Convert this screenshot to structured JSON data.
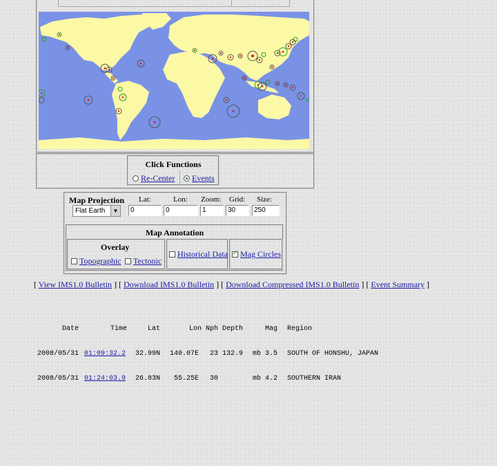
{
  "click_functions": {
    "title": "Click Functions",
    "options": [
      {
        "label": "Re-Center",
        "selected": false
      },
      {
        "label": "Events",
        "selected": true
      }
    ]
  },
  "map_settings": {
    "projection_label": "Map Projection",
    "projection_value": "Flat Earth",
    "lat_label": "Lat:",
    "lat_value": "0",
    "lon_label": "Lon:",
    "lon_value": "0",
    "zoom_label": "Zoom:",
    "zoom_value": "1",
    "grid_label": "Grid:",
    "grid_value": "30",
    "size_label": "Size:",
    "size_value": "250"
  },
  "map_annotation": {
    "title": "Map Annotation",
    "overlay_label": "Overlay",
    "topographic": {
      "label": "Topographic",
      "checked": false
    },
    "tectonic": {
      "label": "Tectonic",
      "checked": false
    },
    "historical": {
      "label": "Historical Data",
      "checked": false
    },
    "mag_circles": {
      "label": "Mag Circles",
      "checked": true
    }
  },
  "links": [
    "View IMS1.0 Bulletin",
    "Download IMS1.0 Bulletin",
    "Download Compressed IMS1.0 Bulletin",
    "Event Summary"
  ],
  "events_table": {
    "headers": [
      "Date",
      "Time",
      "Lat",
      "Lon",
      "Nph",
      "Depth",
      "Mag",
      "Region"
    ],
    "rows": [
      {
        "date": "2008/05/31",
        "time": "01:09:32.2",
        "lat": "32.99N",
        "lon": "140.07E",
        "nph": "23",
        "depth": "132.9",
        "magtype": "mb",
        "mag": "3.5",
        "region": "SOUTH OF HONSHU, JAPAN"
      },
      {
        "date": "2008/05/31",
        "time": "01:24:03.9",
        "lat": "26.83N",
        "lon": "55.25E",
        "nph": "30",
        "depth": "",
        "magtype": "mb",
        "mag": "4.2",
        "region": "SOUTHERN IRAN"
      }
    ]
  },
  "colors": {
    "ocean": "#7a92e6",
    "land": "#fbf8a6",
    "link": "#1a1aa6",
    "event_dot": "#d81c1c",
    "event_ring_green": "#2aa02a"
  }
}
